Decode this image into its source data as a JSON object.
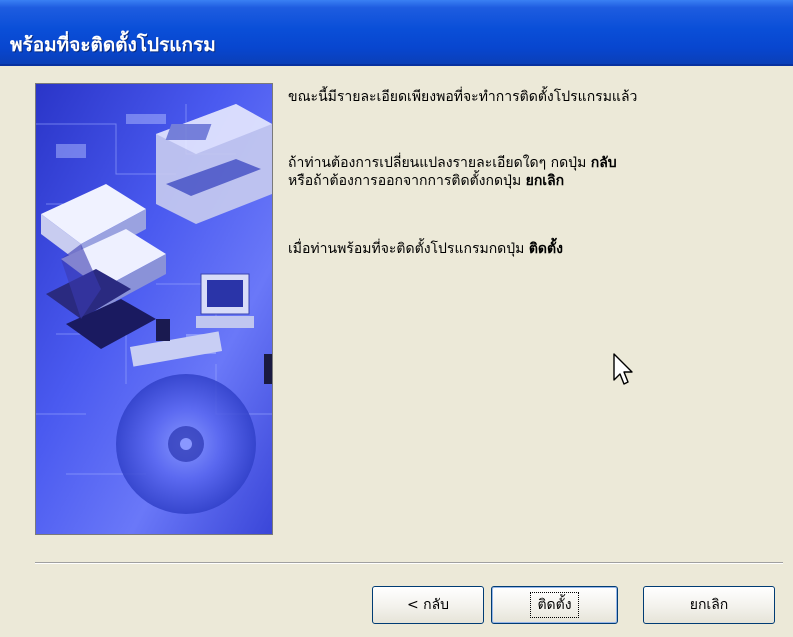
{
  "window": {
    "title": "พร้อมที่จะติดตั้งโปรแกรม"
  },
  "content": {
    "paragraph1": "ขณะนี้มีรายละเอียดเพียงพอที่จะทำการติดตั้งโปรแกรมแล้ว",
    "paragraph2": {
      "line1_prefix": "ถ้าท่านต้องการเปลี่ยนแปลงรายละเอียดใดๆ กดปุ่ม ",
      "line1_bold": "กลับ",
      "line2_prefix": "หรือถ้าต้องการออกจากการติดตั้งกดปุ่ม ",
      "line2_bold": "ยกเลิก"
    },
    "paragraph3": {
      "prefix": "เมื่อท่านพร้อมที่จะติดตั้งโปรแกรมกดปุ่ม ",
      "bold": "ติดตั้ง"
    }
  },
  "buttons": {
    "back": "< กลับ",
    "install": "ติดตั้ง",
    "cancel": "ยกเลิก"
  },
  "colors": {
    "titlebar": "#0a4fd8",
    "background": "#ece9d8",
    "side_image": "#4a55e8"
  },
  "icons": {
    "cursor": "mouse-pointer-icon"
  }
}
